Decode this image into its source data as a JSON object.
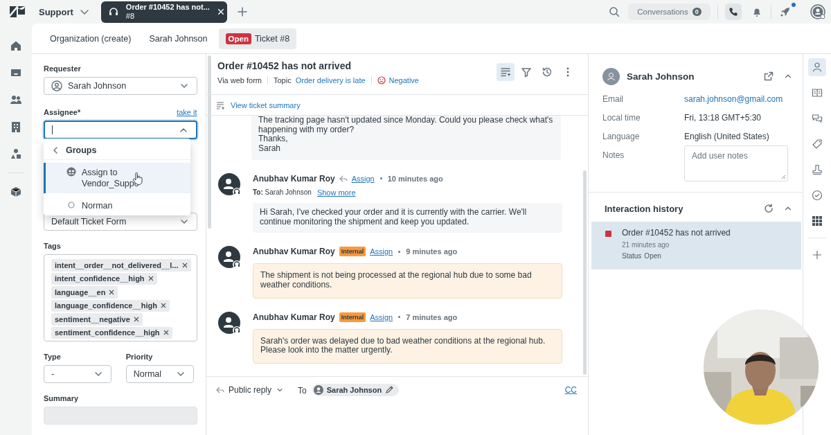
{
  "top_bar": {
    "app_name": "Support",
    "open_tab": {
      "title": "Order #10452 has not...",
      "subtitle": "#8"
    },
    "conversations": {
      "label": "Conversations",
      "count": "0"
    },
    "notification_dot": true
  },
  "context_tabs": [
    {
      "label": "Organization (create)",
      "selected": false
    },
    {
      "label": "Sarah Johnson",
      "selected": false,
      "kind": "plain"
    },
    {
      "status": "Open",
      "label": "Ticket #8",
      "selected": true,
      "kind": "ticket"
    }
  ],
  "ticket_fields": {
    "requester": {
      "label": "Requester",
      "value": "Sarah Johnson"
    },
    "assignee": {
      "label": "Assignee*",
      "link": "take it",
      "expanded": true
    },
    "assignee_menu": {
      "header": "Groups",
      "options": [
        {
          "label": "Assign to Vendor_Suppo",
          "kind": "group",
          "selected": true
        },
        {
          "label": "Norman",
          "kind": "person",
          "selected": false
        }
      ]
    },
    "form": {
      "value": "Default Ticket Form"
    },
    "tags": {
      "label": "Tags",
      "items": [
        "intent__order__not_delivered__l...",
        "intent_confidence__high",
        "language__en",
        "language_confidence__high",
        "sentiment__negative",
        "sentiment_confidence__high"
      ]
    },
    "type": {
      "label": "Type",
      "value": "-"
    },
    "priority": {
      "label": "Priority",
      "value": "Normal"
    },
    "summary": {
      "label": "Summary"
    }
  },
  "ticket": {
    "title": "Order #10452 has not arrived",
    "channel": "Via web form",
    "topic_label": "Topic",
    "topic": "Order delivery is late",
    "sentiment": "Negative",
    "summary_link": "View ticket summary"
  },
  "messages": [
    {
      "kind": "customer",
      "lines": [
        "The tracking page hasn't updated since Monday. Could you please check what's happening with my order?",
        "Thanks,",
        "Sarah"
      ]
    },
    {
      "kind": "public",
      "author": "Anubhav Kumar Roy",
      "action": "Assign",
      "time": "10 minutes ago",
      "to_label": "To:",
      "to": "Sarah Johnson",
      "show_more": "Show more",
      "lines": [
        "Hi Sarah, I've checked your order and it is currently with the carrier. We'll continue monitoring the shipment and keep you updated."
      ]
    },
    {
      "kind": "internal",
      "author": "Anubhav Kumar Roy",
      "badge": "Internal",
      "action": "Assign",
      "time": "9 minutes ago",
      "lines": [
        "The shipment is not being processed at the regional hub due to some bad weather conditions."
      ]
    },
    {
      "kind": "internal",
      "author": "Anubhav Kumar Roy",
      "badge": "Internal",
      "action": "Assign",
      "time": "7 minutes ago",
      "lines": [
        "Sarah's order was delayed due to bad weather conditions at the regional hub. Please look into the matter urgently."
      ]
    }
  ],
  "composer": {
    "mode": "Public reply",
    "to_label": "To",
    "recipient": "Sarah Johnson",
    "cc": "CC"
  },
  "user": {
    "name": "Sarah Johnson",
    "fields": [
      {
        "label": "Email",
        "value": "sarah.johnson@gmail.com",
        "kind": "link"
      },
      {
        "label": "Local time",
        "value": "Fri, 13:18 GMT+5:30",
        "kind": "text"
      },
      {
        "label": "Language",
        "value": "English (United States)",
        "kind": "text"
      },
      {
        "label": "Notes",
        "placeholder": "Add user notes",
        "kind": "notes"
      }
    ]
  },
  "interaction_history": {
    "title": "Interaction history",
    "items": [
      {
        "title": "Order #10452 has not arrived",
        "time": "21 minutes ago",
        "status_label": "Status",
        "status": "Open",
        "color": "#cc3340",
        "selected": true
      }
    ]
  }
}
